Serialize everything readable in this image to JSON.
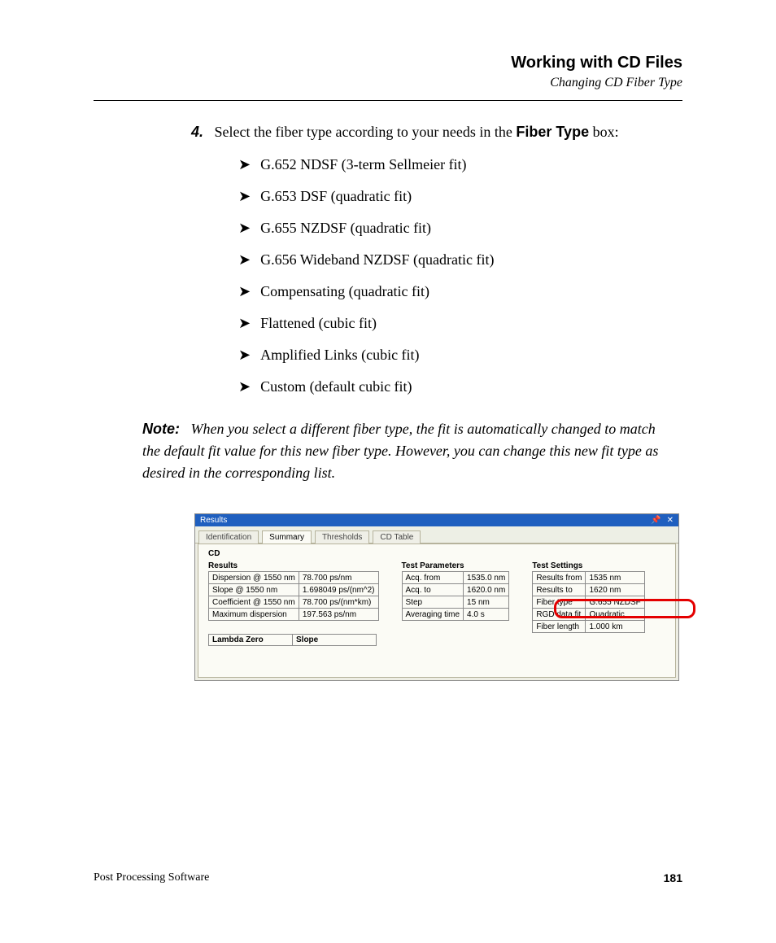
{
  "header": {
    "title": "Working with CD Files",
    "subtitle": "Changing CD Fiber Type"
  },
  "step": {
    "num": "4.",
    "pre": "Select the fiber type according to your needs in the ",
    "bold": "Fiber Type",
    "post": " box:"
  },
  "fibers": [
    "G.652 NDSF (3-term Sellmeier fit)",
    "G.653 DSF (quadratic fit)",
    "G.655 NZDSF (quadratic fit)",
    "G.656 Wideband NZDSF (quadratic fit)",
    "Compensating (quadratic fit)",
    "Flattened (cubic fit)",
    "Amplified Links (cubic fit)",
    "Custom (default cubic fit)"
  ],
  "note": {
    "label": "Note:",
    "body": "When you select a different fiber type, the fit is automatically changed to match the default fit value for this new fiber type. However, you can change this new fit type as desired in the corresponding list."
  },
  "panel": {
    "title": "Results",
    "tabs": [
      "Identification",
      "Summary",
      "Thresholds",
      "CD Table"
    ],
    "active_tab": 1,
    "section": "CD",
    "results_label": "Results",
    "results": [
      [
        "Dispersion @ 1550 nm",
        "78.700 ps/nm"
      ],
      [
        "Slope @ 1550 nm",
        "1.698049 ps/(nm^2)"
      ],
      [
        "Coefficient @ 1550 nm",
        "78.700 ps/(nm*km)"
      ],
      [
        "Maximum dispersion",
        "197.563 ps/nm"
      ]
    ],
    "params_label": "Test Parameters",
    "params": [
      [
        "Acq. from",
        "1535.0 nm"
      ],
      [
        "Acq. to",
        "1620.0 nm"
      ],
      [
        "Step",
        "15 nm"
      ],
      [
        "Averaging time",
        "4.0 s"
      ]
    ],
    "settings_label": "Test Settings",
    "settings": [
      [
        "Results from",
        "1535 nm"
      ],
      [
        "Results to",
        "1620 nm"
      ],
      [
        "Fiber type",
        "G.655 NZDSF"
      ],
      [
        "RGD data fit",
        "Quadratic"
      ],
      [
        "Fiber length",
        "1.000 km"
      ]
    ],
    "lambda": {
      "h1": "Lambda Zero",
      "h2": "Slope"
    }
  },
  "footer": {
    "left": "Post Processing Software",
    "page": "181"
  }
}
